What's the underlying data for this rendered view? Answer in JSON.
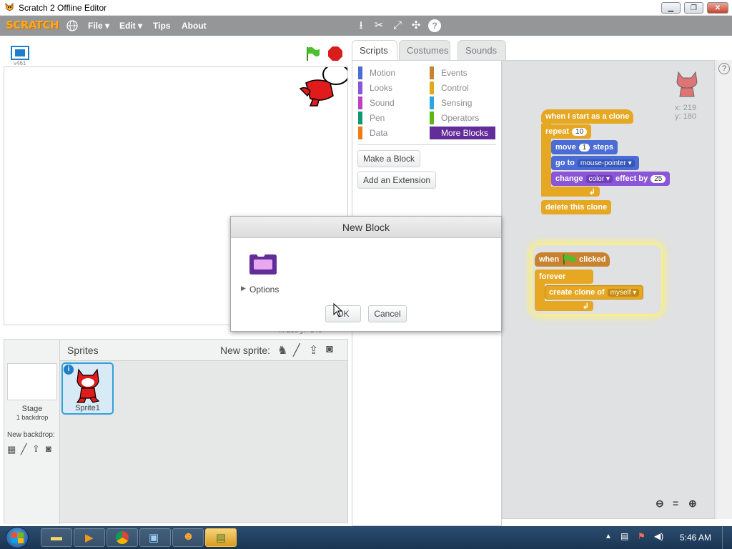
{
  "window": {
    "title": "Scratch 2 Offline Editor",
    "controls": {
      "minimize": "▁",
      "restore": "❐",
      "close": "✕"
    }
  },
  "menubar": {
    "logo": "SCRATCH",
    "file": "File ▾",
    "edit": "Edit ▾",
    "tips": "Tips",
    "about": "About"
  },
  "stage": {
    "version": "v461",
    "coords": "x: 238  y: -146"
  },
  "tabs": {
    "scripts": "Scripts",
    "costumes": "Costumes",
    "sounds": "Sounds"
  },
  "categories": [
    "Motion",
    "Looks",
    "Sound",
    "Pen",
    "Data",
    "Events",
    "Control",
    "Sensing",
    "Operators",
    "More Blocks"
  ],
  "palette": {
    "make_block": "Make a Block",
    "add_extension": "Add an Extension"
  },
  "sprite_info": {
    "x": "x: 219",
    "y": "y: 180"
  },
  "script1": {
    "hat": "when I start as a clone",
    "repeat": "repeat",
    "repeat_n": "10",
    "move": "move",
    "move_n": "1",
    "steps": "steps",
    "goto": "go to",
    "goto_target": "mouse-pointer ▾",
    "change": "change",
    "effect_name": "color ▾",
    "effect_by": "effect by",
    "effect_n": "25",
    "delete": "delete this clone"
  },
  "script2": {
    "when": "when",
    "clicked": "clicked",
    "forever": "forever",
    "create": "create clone of",
    "clone_target": "myself ▾"
  },
  "sprites": {
    "header": "Sprites",
    "new_sprite": "New sprite:",
    "stage_label": "Stage",
    "backdrops": "1 backdrop",
    "new_backdrop": "New backdrop:",
    "sprite1": "Sprite1"
  },
  "dialog": {
    "title": "New Block",
    "options": "Options",
    "ok": "OK",
    "cancel": "Cancel"
  },
  "taskbar": {
    "clock": "5:46 AM"
  }
}
